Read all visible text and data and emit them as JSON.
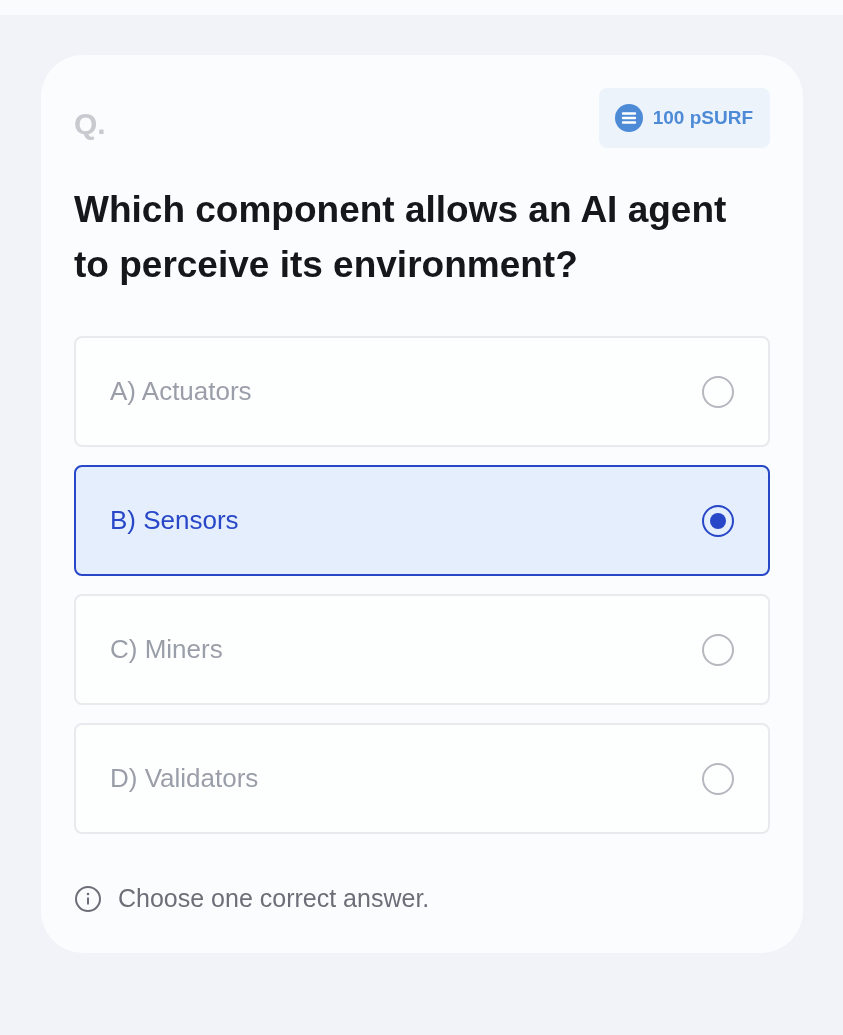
{
  "question": {
    "prefix": "Q.",
    "reward": "100 pSURF",
    "text": "Which component allows an AI agent to perceive its environment?"
  },
  "options": [
    {
      "label": "A) Actuators",
      "selected": false
    },
    {
      "label": "B) Sensors",
      "selected": true
    },
    {
      "label": "C) Miners",
      "selected": false
    },
    {
      "label": "D) Validators",
      "selected": false
    }
  ],
  "hint": "Choose one correct answer."
}
